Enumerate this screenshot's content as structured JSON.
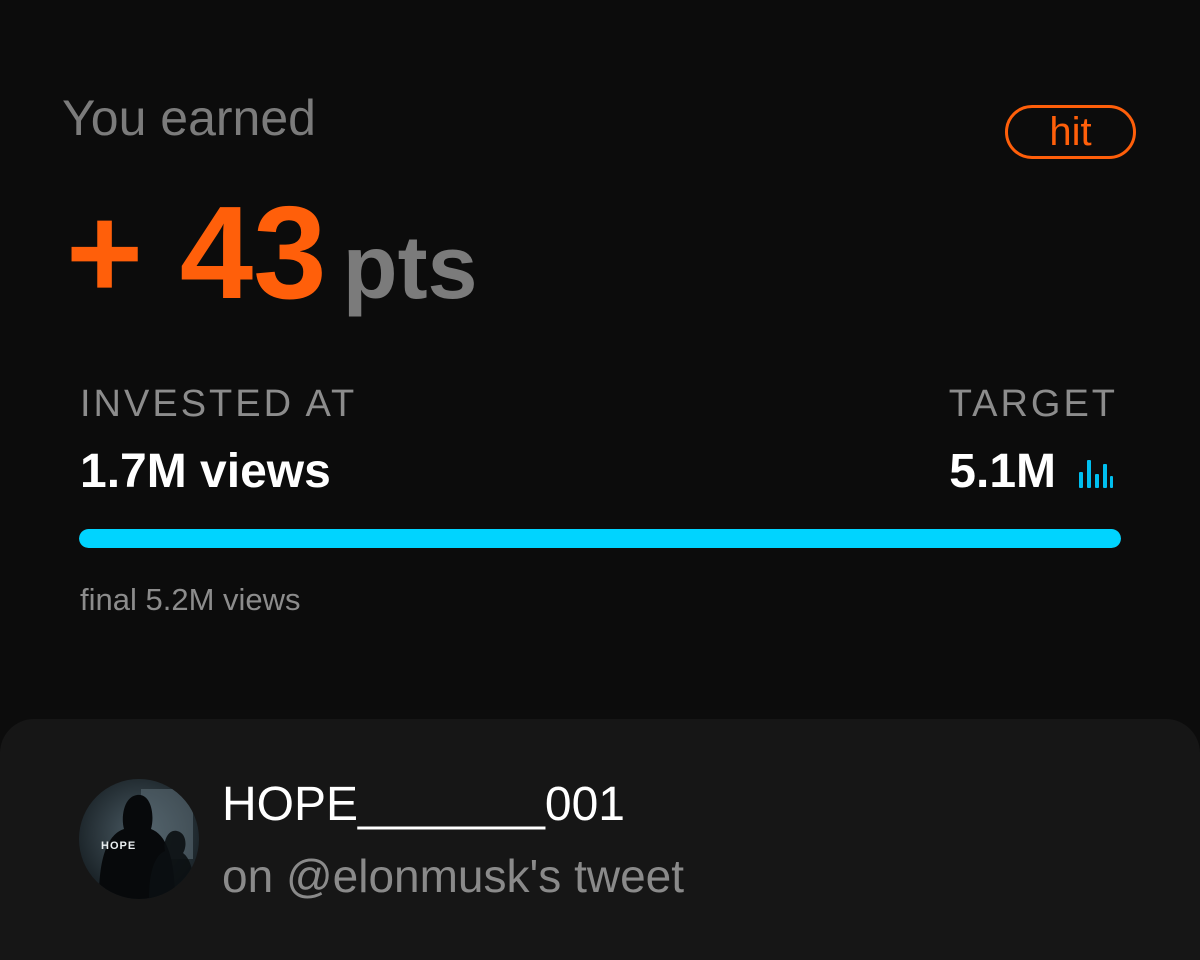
{
  "result": {
    "earned_label": "You earned",
    "points_value": "+ 43",
    "points_unit": "pts",
    "status_badge": "hit"
  },
  "stats": {
    "invested_caption": "INVESTED AT",
    "invested_value": "1.7M views",
    "target_caption": "TARGET",
    "target_value": "5.1M",
    "target_icon": "bar-chart-icon",
    "progress_fraction": 1.0,
    "final_text": "final 5.2M views"
  },
  "post": {
    "avatar_text": "HOPE",
    "username": "HOPE_______001",
    "subtitle": "on @elonmusk's tweet"
  },
  "colors": {
    "accent_orange": "#ff5f0a",
    "progress_cyan": "#00d4ff",
    "background": "#0c0c0c",
    "card": "#161616",
    "muted_text": "#7b7b7b"
  }
}
